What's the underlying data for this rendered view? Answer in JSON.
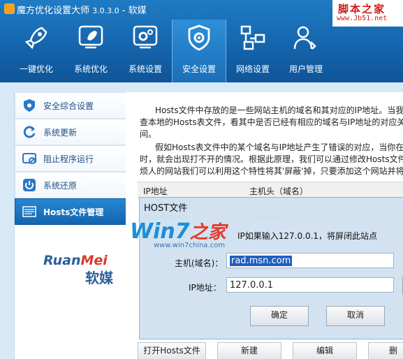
{
  "window": {
    "title": "魔方优化设置大师",
    "version": "3.0.3.0",
    "vendor": "- 软媒"
  },
  "watermark": {
    "title": "脚本之家",
    "url": "www.Jb51.net"
  },
  "toolbar": {
    "items": [
      {
        "label": "一键优化",
        "icon": "rocket-icon"
      },
      {
        "label": "系统优化",
        "icon": "rocket-screen-icon"
      },
      {
        "label": "系统设置",
        "icon": "gears-screen-icon"
      },
      {
        "label": "安全设置",
        "icon": "shield-gear-icon",
        "active": true
      },
      {
        "label": "网络设置",
        "icon": "network-icon"
      },
      {
        "label": "用户管理",
        "icon": "users-icon"
      }
    ]
  },
  "sidebar": {
    "items": [
      {
        "label": "安全综合设置",
        "icon": "shield-gear-icon"
      },
      {
        "label": "系统更新",
        "icon": "refresh-icon"
      },
      {
        "label": "阻止程序运行",
        "icon": "block-program-icon"
      },
      {
        "label": "系统还原",
        "icon": "restore-icon"
      },
      {
        "label": "Hosts文件管理",
        "icon": "hosts-file-icon",
        "active": true
      }
    ]
  },
  "content": {
    "para1_line1": "Hosts文件中存放的是一些网站主机的域名和其对应的IP地址。当我",
    "para1_line2": "查本地的Hosts表文件，看其中是否已经有相应的域名与IP地址的对应关",
    "para1_line3": "间。",
    "para2_line1": "假如Hosts表文件中的某个域名与IP地址产生了错误的对应，当你在",
    "para2_line2": "时，就会出现打不开的情况。根据此原理，我们可以通过修改Hosts文件",
    "para2_line3": "烦人的网站我们可以利用这个特性将其'屏蔽'掉，只要添加这个网站并将",
    "table": {
      "col_ip": "IP地址",
      "col_host": "主机头（域名）"
    },
    "buttons": {
      "open": "打开Hosts文件",
      "new": "新建",
      "edit": "编辑",
      "delete": "删"
    }
  },
  "dialog": {
    "title": "HOST文件",
    "tip": "IP如果输入127.0.0.1，将屏闭此站点",
    "host_label": "主机(域名)：",
    "host_value": "rad.msn.com",
    "ip_label": "IP地址：",
    "ip_value": "127.0.0.1",
    "ok": "确定",
    "cancel": "取消"
  },
  "logos": {
    "ruanmei_en_a": "Ruan",
    "ruanmei_en_b": "Mei",
    "ruanmei_cn": "软媒",
    "win7_a": "Win7",
    "win7_b": "之家",
    "win7_url": "www.win7china.com"
  },
  "colors": {
    "titlebar": "#1565ad",
    "active_tab": "#2d8fd8",
    "sidebar_active": "#1365b0",
    "dialog_bg": "#cedff0",
    "selection": "#1f5fbf"
  }
}
